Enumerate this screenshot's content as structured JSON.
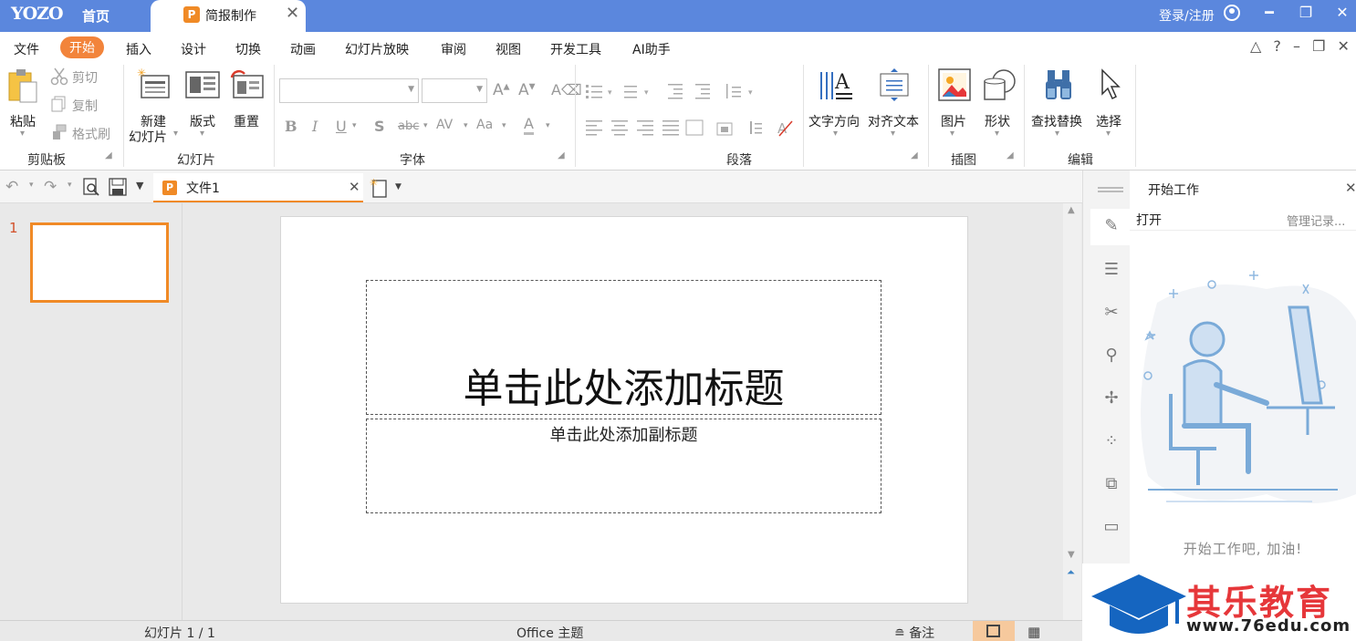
{
  "titlebar": {
    "logo": "YOZO",
    "home_tab": "首页",
    "doc_tab": "简报制作",
    "doc_tab_icon": "P",
    "close": "✕",
    "login": "登录/注册",
    "minimize": "━",
    "restore": "❐",
    "close_window": "✕"
  },
  "menu": {
    "items": [
      "文件",
      "开始",
      "插入",
      "设计",
      "切换",
      "动画",
      "幻灯片放映",
      "审阅",
      "视图",
      "开发工具",
      "AI助手"
    ],
    "right": {
      "up": "△",
      "help": "?",
      "min": "–",
      "restore": "❐",
      "close": "✕"
    }
  },
  "ribbon": {
    "clipboard": {
      "paste": "粘贴",
      "cut": "剪切",
      "copy": "复制",
      "format_painter": "格式刷",
      "group": "剪贴板"
    },
    "slides": {
      "new_line1": "新建",
      "new_line2": "幻灯片",
      "layout": "版式",
      "reset": "重置",
      "group": "幻灯片"
    },
    "font": {
      "group": "字体",
      "bold": "B",
      "italic": "I",
      "underline": "U",
      "shadow": "S",
      "strike": "abc",
      "spacing": "AV",
      "case": "Aa",
      "color": "A",
      "grow": "A",
      "shrink": "A"
    },
    "paragraph": {
      "group": "段落"
    },
    "text_direction": "文字方向",
    "align_text": "对齐文本",
    "insert": {
      "picture": "图片",
      "shape": "形状",
      "group": "插图"
    },
    "edit": {
      "find_replace": "查找替换",
      "select": "选择",
      "group": "编辑"
    }
  },
  "quickbar": {
    "file_tab": "文件1",
    "file_tab_icon": "P",
    "close": "✕"
  },
  "thumbnails": [
    {
      "number": "1"
    }
  ],
  "slide": {
    "title_placeholder": "单击此处添加标题",
    "subtitle_placeholder": "单击此处添加副标题"
  },
  "taskpane": {
    "title": "开始工作",
    "close": "✕",
    "open": "打开",
    "manage": "管理记录...",
    "slogan": "开始工作吧, 加油!"
  },
  "statusbar": {
    "slide_count": "幻灯片 1 / 1",
    "theme": "Office 主题",
    "notes": "备注"
  },
  "watermark": {
    "brand": "其乐教育",
    "url": "www.76edu.com"
  },
  "colors": {
    "titlebar": "#5b87dd",
    "accent": "#f08a26",
    "illustration": "#8fb8e0"
  }
}
